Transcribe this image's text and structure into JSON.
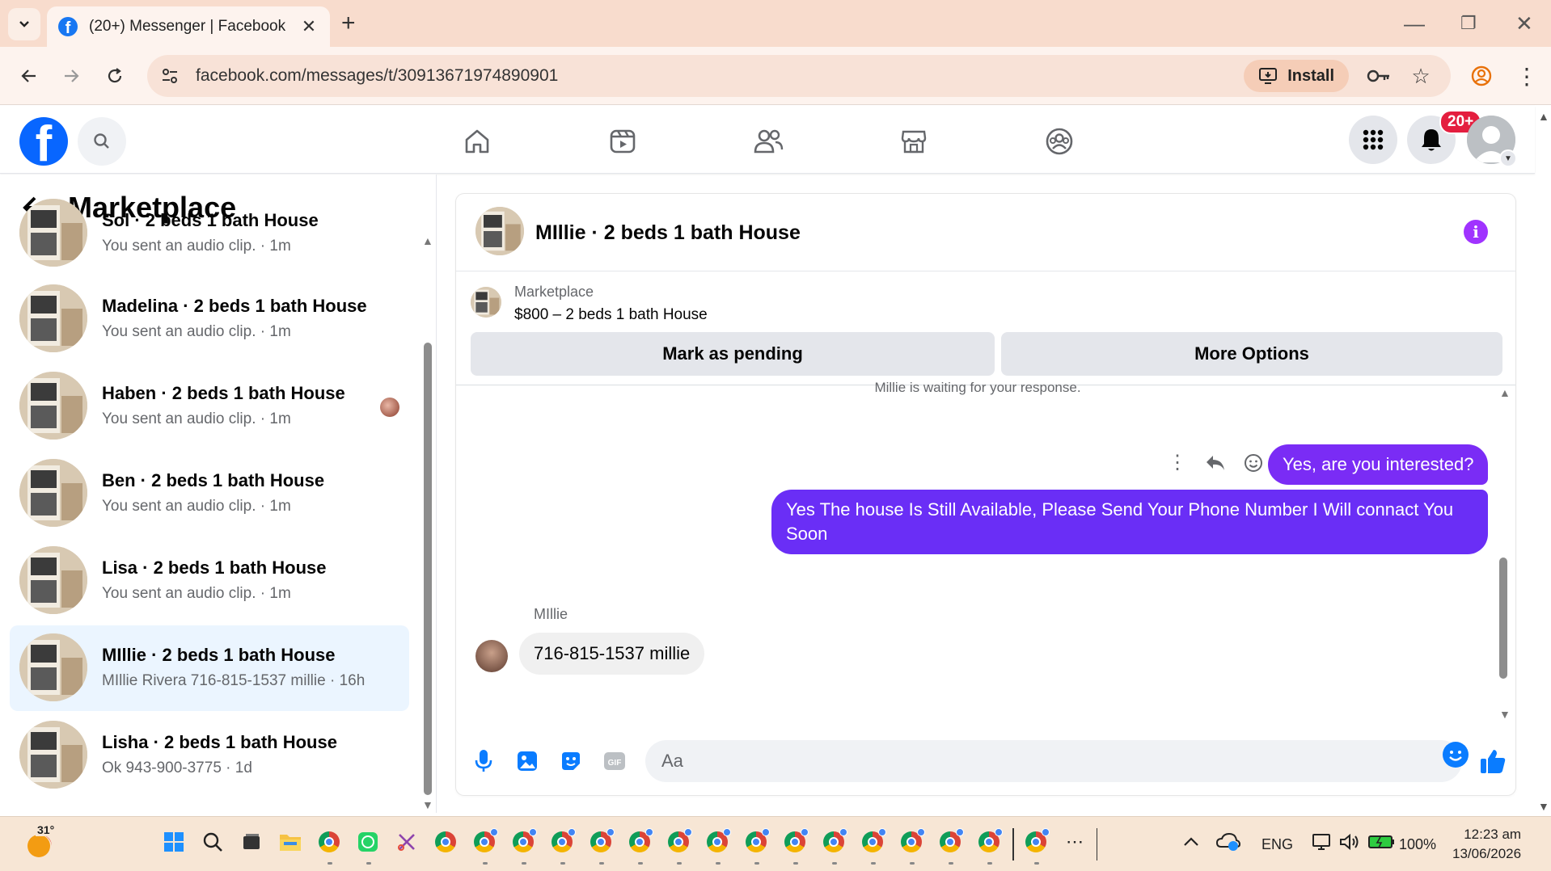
{
  "browser": {
    "tab_title": "(20+) Messenger | Facebook",
    "url": "facebook.com/messages/t/30913671974890901",
    "install_label": "Install"
  },
  "facebook": {
    "notification_badge": "20+"
  },
  "left_panel": {
    "title": "Marketplace",
    "conversations": [
      {
        "name": "Sol · 2 beds 1 bath House",
        "preview": "You sent an audio clip. · 1m",
        "active": false
      },
      {
        "name": "Madelina · 2 beds 1 bath House",
        "preview": "You sent an audio clip. · 1m",
        "active": false
      },
      {
        "name": "Haben · 2 beds 1 bath House",
        "preview": "You sent an audio clip. · 1m",
        "active": false,
        "seen_avatar": true
      },
      {
        "name": "Ben · 2 beds 1 bath House",
        "preview": "You sent an audio clip. · 1m",
        "active": false
      },
      {
        "name": "Lisa · 2 beds 1 bath House",
        "preview": "You sent an audio clip. · 1m",
        "active": false
      },
      {
        "name": "MIllie · 2 beds 1 bath House",
        "preview": "MIllie Rivera 716-815-1537 millie · 16h",
        "active": true
      },
      {
        "name": "Lisha · 2 beds 1 bath House",
        "preview": "Ok 943-900-3775 · 1d",
        "active": false
      }
    ]
  },
  "chat": {
    "header_name": "MIllie · 2 beds 1 bath House",
    "marketplace_label": "Marketplace",
    "listing": "$800 – 2 beds 1 bath House",
    "mark_pending_label": "Mark as pending",
    "more_options_label": "More Options",
    "waiting_text": "Millie is waiting for your response.",
    "messages": {
      "out_1": "Yes, are you interested?",
      "out_2": "Yes The house Is Still Available, Please Send Your Phone Number I Will connact You Soon",
      "in_sender": "MIllie",
      "in_1": "716-815-1537 millie"
    },
    "composer_placeholder": "Aa"
  },
  "taskbar": {
    "temperature": "31°",
    "language": "ENG",
    "battery": "100%",
    "time": "12:23 am",
    "date": "13/06/2026"
  },
  "colors": {
    "fb_blue": "#0866ff",
    "outgoing_bubble": "#7a2cf5",
    "active_conversation": "#ebf5ff",
    "badge_red": "#e41e3f"
  }
}
